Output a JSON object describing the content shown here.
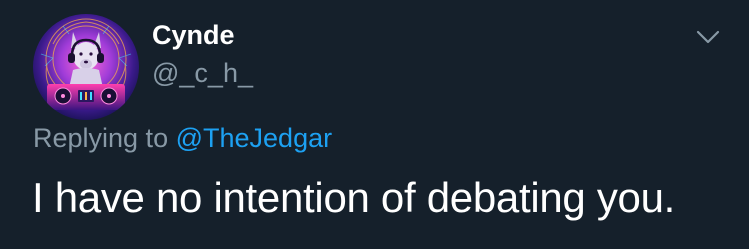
{
  "tweet": {
    "author": {
      "display_name": "Cynde",
      "handle": "@_c_h_",
      "avatar_icon": "dj-dog-avatar"
    },
    "menu_icon": "chevron-down-icon",
    "reply_context": {
      "prefix": "Replying to",
      "mention": "@TheJedgar"
    },
    "text": "I have no intention of debating you."
  },
  "colors": {
    "background": "#15202b",
    "primary_text": "#ffffff",
    "secondary_text": "#8899a6",
    "accent": "#1da1f2"
  }
}
